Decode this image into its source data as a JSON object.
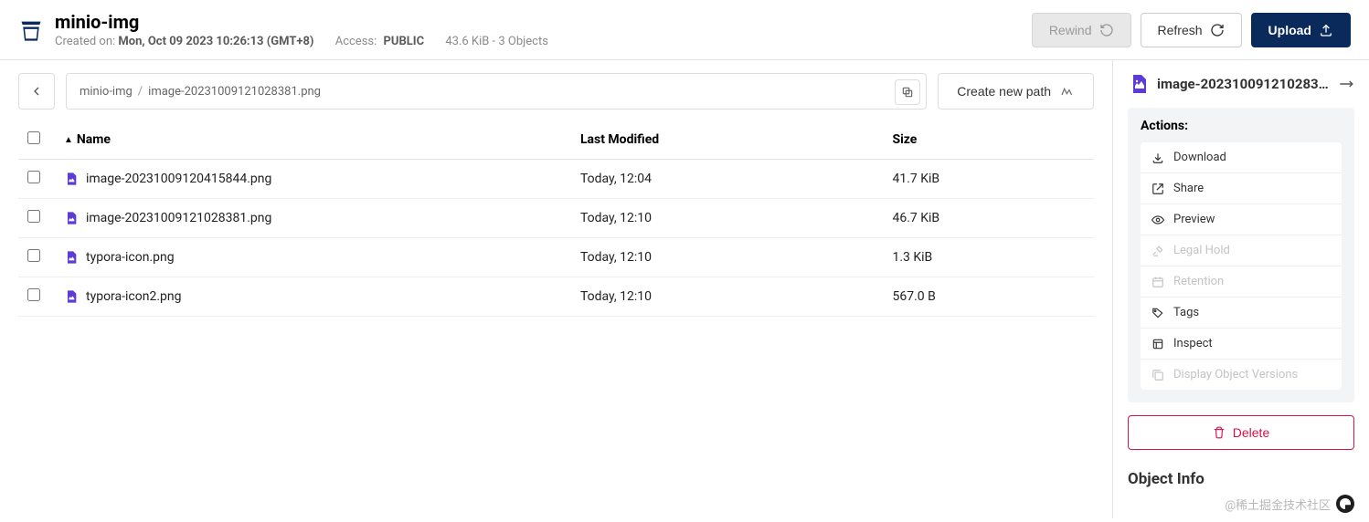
{
  "bucket": {
    "name": "minio-img",
    "created_label": "Created on:",
    "created_value": "Mon, Oct 09 2023 10:26:13 (GMT+8)",
    "access_label": "Access:",
    "access_value": "PUBLIC",
    "stats": "43.6 KiB - 3 Objects"
  },
  "header_buttons": {
    "rewind": "Rewind",
    "refresh": "Refresh",
    "upload": "Upload"
  },
  "breadcrumb": {
    "root": "minio-img",
    "path": "image-20231009121028381.png"
  },
  "create_path": "Create new path",
  "table": {
    "col_name": "Name",
    "col_modified": "Last Modified",
    "col_size": "Size",
    "rows": [
      {
        "name": "image-20231009120415844.png",
        "modified": "Today, 12:04",
        "size": "41.7 KiB"
      },
      {
        "name": "image-20231009121028381.png",
        "modified": "Today, 12:10",
        "size": "46.7 KiB"
      },
      {
        "name": "typora-icon.png",
        "modified": "Today, 12:10",
        "size": "1.3 KiB"
      },
      {
        "name": "typora-icon2.png",
        "modified": "Today, 12:10",
        "size": "567.0 B"
      }
    ]
  },
  "sidebar": {
    "selected_file": "image-20231009121028381....",
    "actions_label": "Actions:",
    "actions": {
      "download": "Download",
      "share": "Share",
      "preview": "Preview",
      "legal_hold": "Legal Hold",
      "retention": "Retention",
      "tags": "Tags",
      "inspect": "Inspect",
      "versions": "Display Object Versions"
    },
    "delete": "Delete",
    "object_info": "Object Info"
  },
  "watermark": "@稀土掘金技术社区"
}
